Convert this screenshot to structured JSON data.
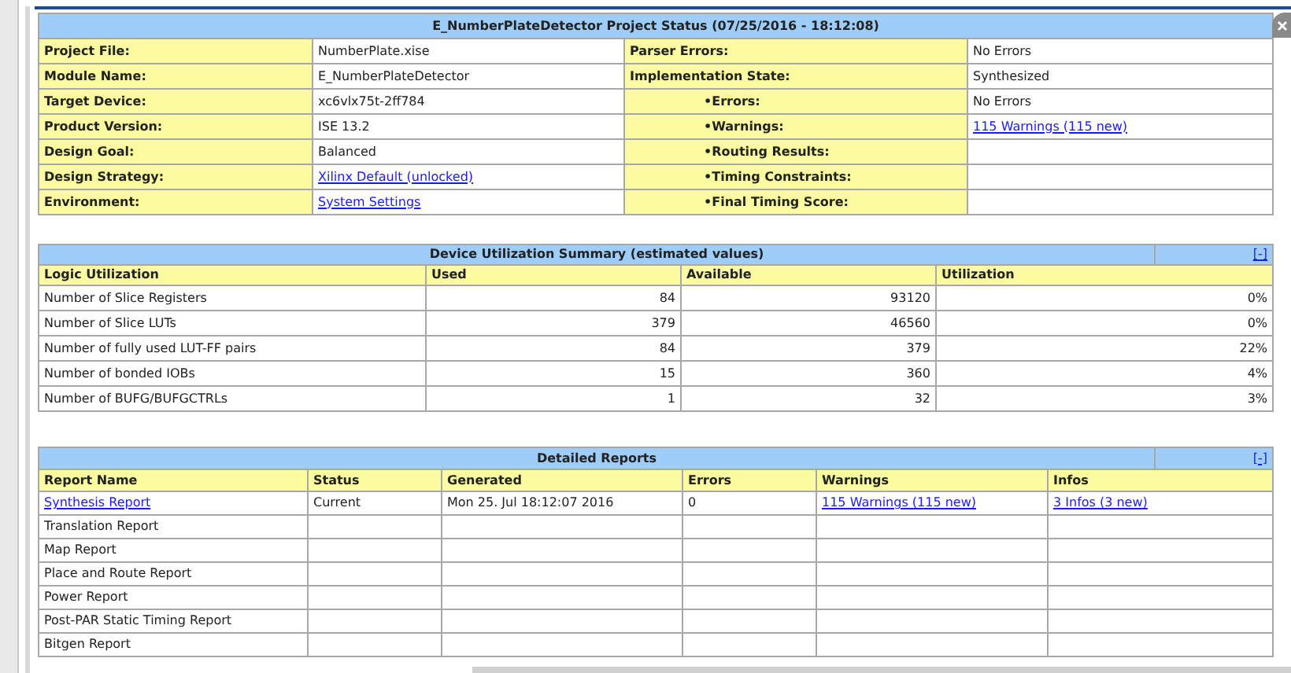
{
  "project_status": {
    "title": "E_NumberPlateDetector Project Status (07/25/2016 - 18:12:08)",
    "rows": [
      {
        "cells": [
          {
            "kind": "label",
            "text": "Project File:"
          },
          {
            "kind": "value",
            "text": "NumberPlate.xise"
          },
          {
            "kind": "label",
            "text": "Parser Errors:"
          },
          {
            "kind": "value",
            "text": "No Errors"
          }
        ]
      },
      {
        "cells": [
          {
            "kind": "label",
            "text": "Module Name:"
          },
          {
            "kind": "value",
            "text": "E_NumberPlateDetector"
          },
          {
            "kind": "label",
            "text": "Implementation State:"
          },
          {
            "kind": "value",
            "text": "Synthesized"
          }
        ]
      },
      {
        "cells": [
          {
            "kind": "label",
            "text": "Target Device:"
          },
          {
            "kind": "value",
            "text": "xc6vlx75t-2ff784"
          },
          {
            "kind": "sublabel",
            "text": "•Errors:"
          },
          {
            "kind": "value",
            "text": "No Errors"
          }
        ]
      },
      {
        "cells": [
          {
            "kind": "label",
            "text": "Product Version:"
          },
          {
            "kind": "value",
            "text": "ISE 13.2"
          },
          {
            "kind": "sublabel",
            "text": "•Warnings:"
          },
          {
            "kind": "link",
            "text": "115 Warnings (115 new)"
          }
        ]
      },
      {
        "cells": [
          {
            "kind": "label",
            "text": "Design Goal:"
          },
          {
            "kind": "value",
            "text": "Balanced"
          },
          {
            "kind": "sublabel",
            "text": "•Routing Results:"
          },
          {
            "kind": "empty"
          }
        ]
      },
      {
        "cells": [
          {
            "kind": "label",
            "text": "Design Strategy:"
          },
          {
            "kind": "link",
            "text": "Xilinx Default (unlocked)"
          },
          {
            "kind": "sublabel",
            "text": "•Timing Constraints:"
          },
          {
            "kind": "empty"
          }
        ]
      },
      {
        "cells": [
          {
            "kind": "label",
            "text": "Environment:"
          },
          {
            "kind": "link",
            "text": "System Settings"
          },
          {
            "kind": "sublabel",
            "text": "•Final Timing Score:"
          },
          {
            "kind": "empty"
          }
        ]
      }
    ]
  },
  "utilization": {
    "title": "Device Utilization Summary (estimated values)",
    "toggle": "[-]",
    "columns": [
      "Logic Utilization",
      "Used",
      "Available",
      "Utilization"
    ],
    "rows": [
      {
        "cells": [
          {
            "kind": "value",
            "text": "Number of Slice Registers"
          },
          {
            "kind": "number",
            "text": "84"
          },
          {
            "kind": "number",
            "text": "93120"
          },
          {
            "kind": "number",
            "text": "0%"
          }
        ]
      },
      {
        "cells": [
          {
            "kind": "value",
            "text": "Number of Slice LUTs"
          },
          {
            "kind": "number",
            "text": "379"
          },
          {
            "kind": "number",
            "text": "46560"
          },
          {
            "kind": "number",
            "text": "0%"
          }
        ]
      },
      {
        "cells": [
          {
            "kind": "value",
            "text": "Number of fully used LUT-FF pairs"
          },
          {
            "kind": "number",
            "text": "84"
          },
          {
            "kind": "number",
            "text": "379"
          },
          {
            "kind": "number",
            "text": "22%"
          }
        ]
      },
      {
        "cells": [
          {
            "kind": "value",
            "text": "Number of bonded IOBs"
          },
          {
            "kind": "number",
            "text": "15"
          },
          {
            "kind": "number",
            "text": "360"
          },
          {
            "kind": "number",
            "text": "4%"
          }
        ]
      },
      {
        "cells": [
          {
            "kind": "value",
            "text": "Number of BUFG/BUFGCTRLs"
          },
          {
            "kind": "number",
            "text": "1"
          },
          {
            "kind": "number",
            "text": "32"
          },
          {
            "kind": "number",
            "text": "3%"
          }
        ]
      }
    ]
  },
  "reports": {
    "title": "Detailed Reports",
    "toggle": "[-]",
    "columns": [
      "Report Name",
      "Status",
      "Generated",
      "Errors",
      "Warnings",
      "Infos"
    ],
    "rows": [
      {
        "cells": [
          {
            "kind": "link",
            "text": "Synthesis Report"
          },
          {
            "kind": "value",
            "text": "Current"
          },
          {
            "kind": "value",
            "text": "Mon 25. Jul 18:12:07 2016"
          },
          {
            "kind": "value",
            "text": "0"
          },
          {
            "kind": "link",
            "text": "115 Warnings (115 new)"
          },
          {
            "kind": "link",
            "text": "3 Infos (3 new)"
          }
        ]
      },
      {
        "cells": [
          {
            "kind": "value",
            "text": "Translation Report"
          },
          {
            "kind": "empty"
          },
          {
            "kind": "empty"
          },
          {
            "kind": "empty"
          },
          {
            "kind": "empty"
          },
          {
            "kind": "empty"
          }
        ]
      },
      {
        "cells": [
          {
            "kind": "value",
            "text": "Map Report"
          },
          {
            "kind": "empty"
          },
          {
            "kind": "empty"
          },
          {
            "kind": "empty"
          },
          {
            "kind": "empty"
          },
          {
            "kind": "empty"
          }
        ]
      },
      {
        "cells": [
          {
            "kind": "value",
            "text": "Place and Route Report"
          },
          {
            "kind": "empty"
          },
          {
            "kind": "empty"
          },
          {
            "kind": "empty"
          },
          {
            "kind": "empty"
          },
          {
            "kind": "empty"
          }
        ]
      },
      {
        "cells": [
          {
            "kind": "value",
            "text": "Power Report"
          },
          {
            "kind": "empty"
          },
          {
            "kind": "empty"
          },
          {
            "kind": "empty"
          },
          {
            "kind": "empty"
          },
          {
            "kind": "empty"
          }
        ]
      },
      {
        "cells": [
          {
            "kind": "value",
            "text": "Post-PAR Static Timing Report"
          },
          {
            "kind": "empty"
          },
          {
            "kind": "empty"
          },
          {
            "kind": "empty"
          },
          {
            "kind": "empty"
          },
          {
            "kind": "empty"
          }
        ]
      },
      {
        "cells": [
          {
            "kind": "value",
            "text": "Bitgen Report"
          },
          {
            "kind": "empty"
          },
          {
            "kind": "empty"
          },
          {
            "kind": "empty"
          },
          {
            "kind": "empty"
          },
          {
            "kind": "empty"
          }
        ]
      }
    ]
  }
}
